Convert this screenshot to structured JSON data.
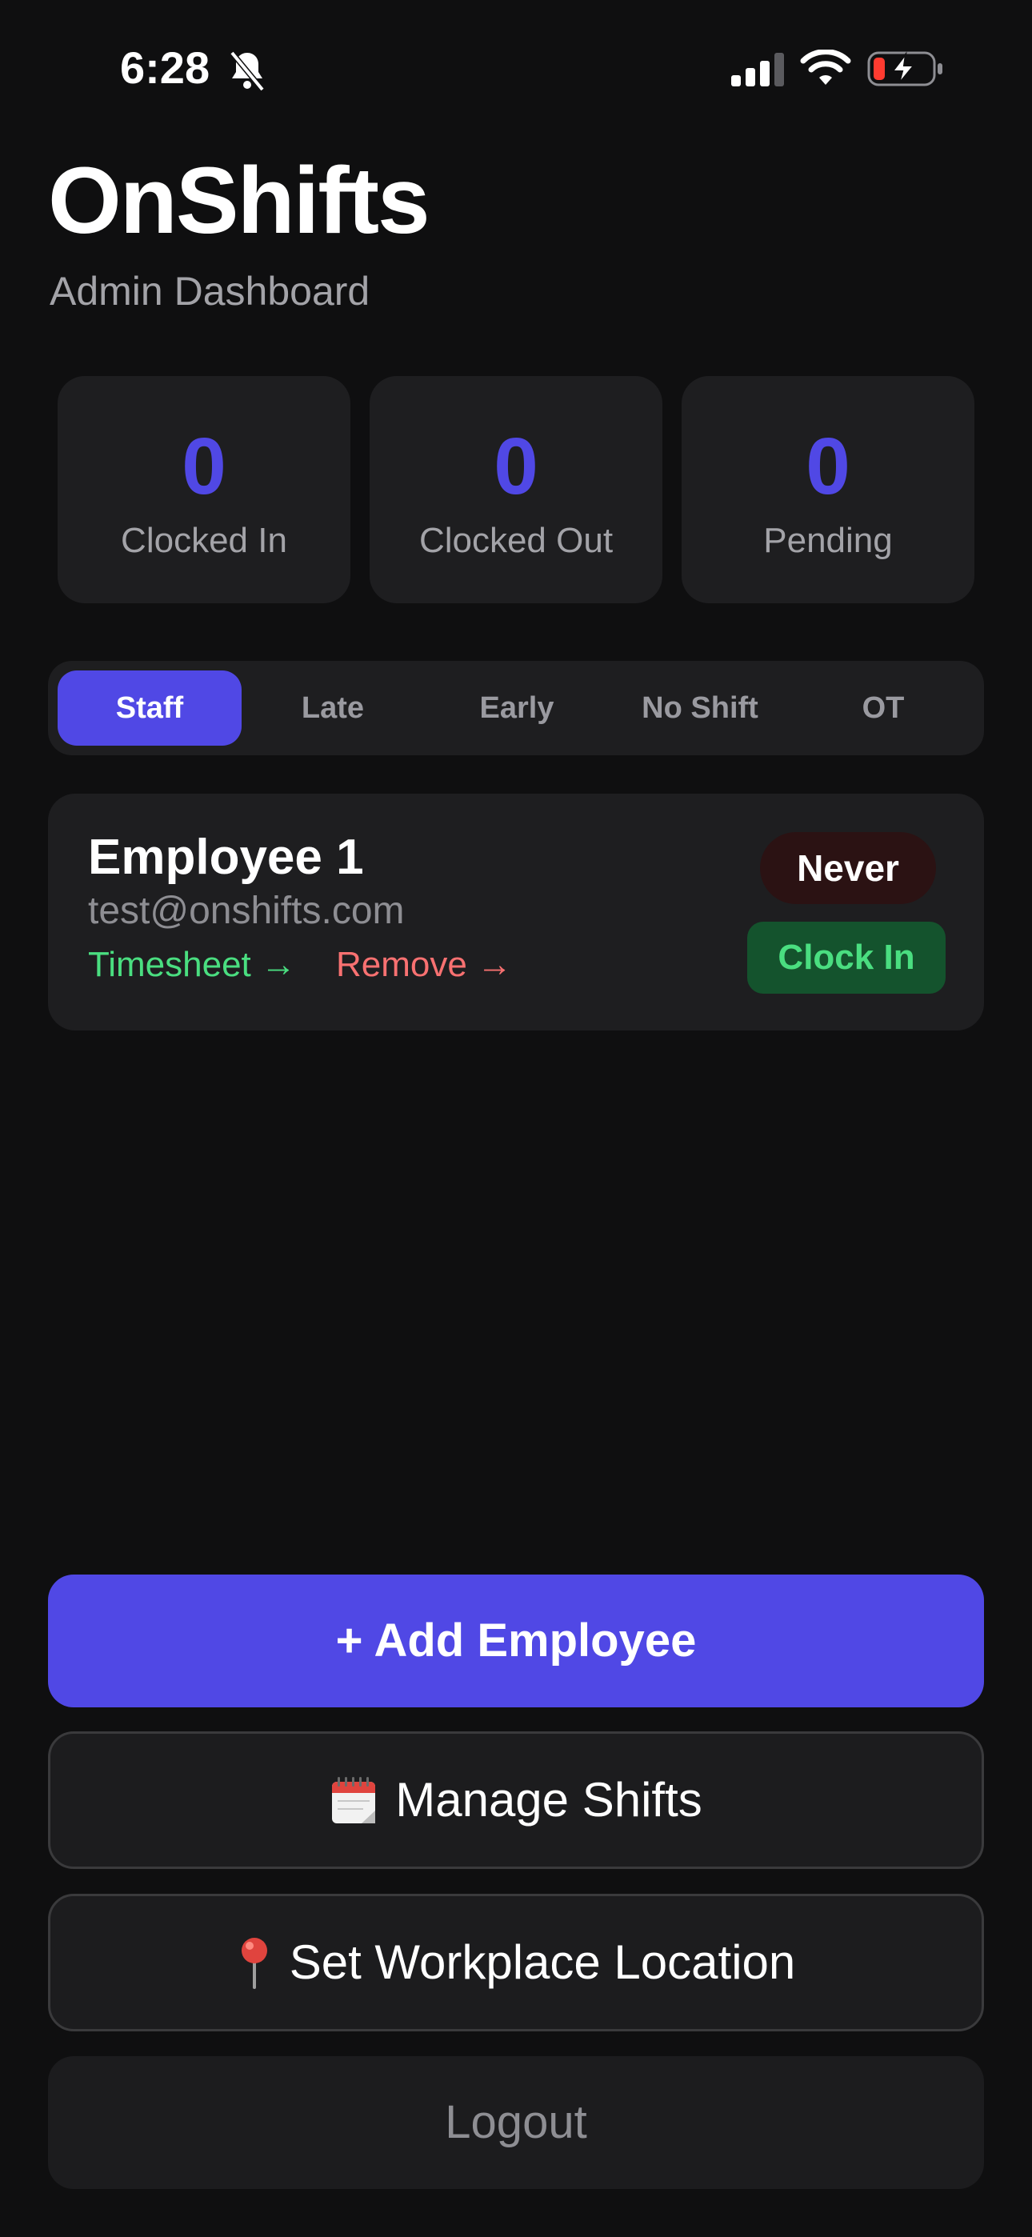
{
  "status_bar": {
    "time": "6:28",
    "icons": [
      "bell-slash-icon",
      "cellular-signal-icon",
      "wifi-icon",
      "battery-charging-icon"
    ]
  },
  "header": {
    "title": "OnShifts",
    "subtitle": "Admin Dashboard"
  },
  "stats": [
    {
      "value": "0",
      "label": "Clocked In"
    },
    {
      "value": "0",
      "label": "Clocked Out"
    },
    {
      "value": "0",
      "label": "Pending"
    }
  ],
  "tabs": [
    {
      "label": "Staff",
      "active": true
    },
    {
      "label": "Late",
      "active": false
    },
    {
      "label": "Early",
      "active": false
    },
    {
      "label": "No Shift",
      "active": false
    },
    {
      "label": "OT",
      "active": false
    }
  ],
  "employees": [
    {
      "name": "Employee 1",
      "email": "test@onshifts.com",
      "timesheet_link": "Timesheet →",
      "remove_link": "Remove →",
      "status": "Never",
      "clock_in_label": "Clock In"
    }
  ],
  "actions": {
    "add_employee": "+ Add Employee",
    "manage_shifts": "Manage Shifts",
    "set_location": "Set Workplace Location",
    "logout": "Logout"
  },
  "colors": {
    "background": "#0f0f10",
    "card": "#1e1e20",
    "accent": "#5048e5",
    "success": "#4ade80",
    "danger": "#f87171",
    "muted": "#a3a3a8"
  }
}
